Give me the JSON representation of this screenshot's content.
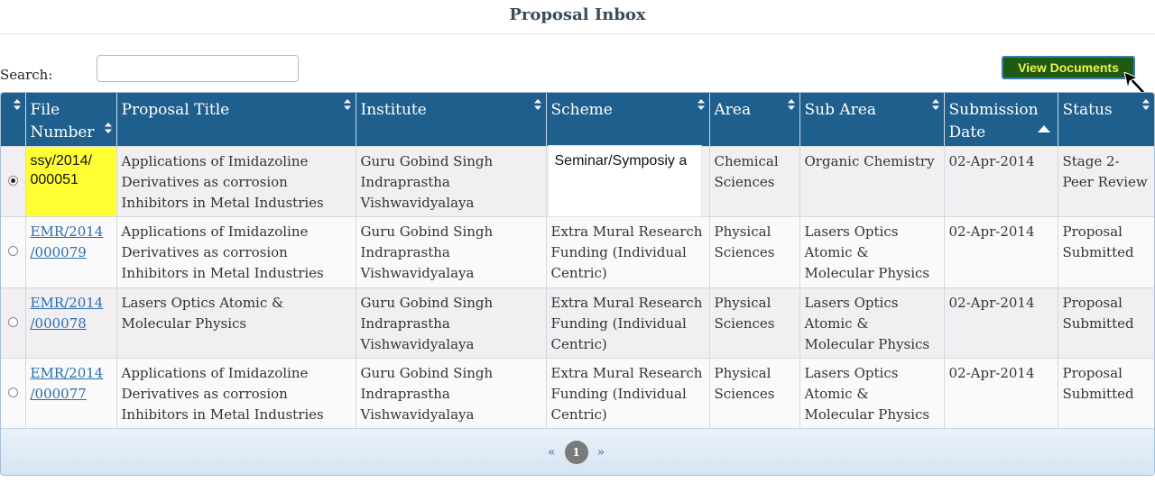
{
  "page": {
    "title": "Proposal Inbox"
  },
  "search": {
    "label": "Search:",
    "value": ""
  },
  "toolbar": {
    "view_documents_label": "View Documents"
  },
  "table": {
    "headers": {
      "file_number": "File Number",
      "proposal_title": "Proposal Title",
      "institute": "Institute",
      "scheme": "Scheme",
      "area": "Area",
      "sub_area": "Sub Area",
      "submission_date": "Submission Date",
      "status": "Status"
    },
    "rows": [
      {
        "selected": true,
        "file_number": "ssy/2014/ 000051",
        "proposal_title": "Applications of Imidazoline Derivatives as corrosion Inhibitors in Metal Industries",
        "institute": "Guru Gobind Singh Indraprastha Vishwavidyalaya",
        "scheme": "Seminar/Symposiy a",
        "area": "Chemical Sciences",
        "sub_area": "Organic Chemistry",
        "submission_date": "02-Apr-2014",
        "status": "Stage 2- Peer Review"
      },
      {
        "selected": false,
        "file_number": "EMR/2014 /000079",
        "proposal_title": "Applications of Imidazoline Derivatives as corrosion Inhibitors in Metal Industries",
        "institute": "Guru Gobind Singh Indraprastha Vishwavidyalaya",
        "scheme": "Extra Mural Research Funding (Individual Centric)",
        "area": "Physical Sciences",
        "sub_area": "Lasers Optics Atomic & Molecular Physics",
        "submission_date": "02-Apr-2014",
        "status": "Proposal Submitted"
      },
      {
        "selected": false,
        "file_number": "EMR/2014 /000078",
        "proposal_title": "Lasers Optics Atomic & Molecular Physics",
        "institute": "Guru Gobind Singh Indraprastha Vishwavidyalaya",
        "scheme": "Extra Mural Research Funding (Individual Centric)",
        "area": "Physical Sciences",
        "sub_area": "Lasers Optics Atomic & Molecular Physics",
        "submission_date": "02-Apr-2014",
        "status": "Proposal Submitted"
      },
      {
        "selected": false,
        "file_number": "EMR/2014 /000077",
        "proposal_title": "Applications of Imidazoline Derivatives as corrosion Inhibitors in Metal Industries",
        "institute": "Guru Gobind Singh Indraprastha Vishwavidyalaya",
        "scheme": "Extra Mural Research Funding (Individual Centric)",
        "area": "Physical Sciences",
        "sub_area": "Lasers Optics Atomic & Molecular Physics",
        "submission_date": "02-Apr-2014",
        "status": "Proposal Submitted"
      }
    ]
  },
  "pagination": {
    "prev": "«",
    "current": "1",
    "next": "»"
  },
  "colors": {
    "header_bg": "#1e5f8e",
    "button_bg": "#1f5a12",
    "button_text": "#f2f24a",
    "highlight": "#ffff33",
    "link": "#2a6db0"
  },
  "icons": {
    "sort": "sort-icon",
    "sort_ascending": "sort-up-icon",
    "cursor": "cursor-arrow-icon",
    "radio": "radio-button"
  }
}
